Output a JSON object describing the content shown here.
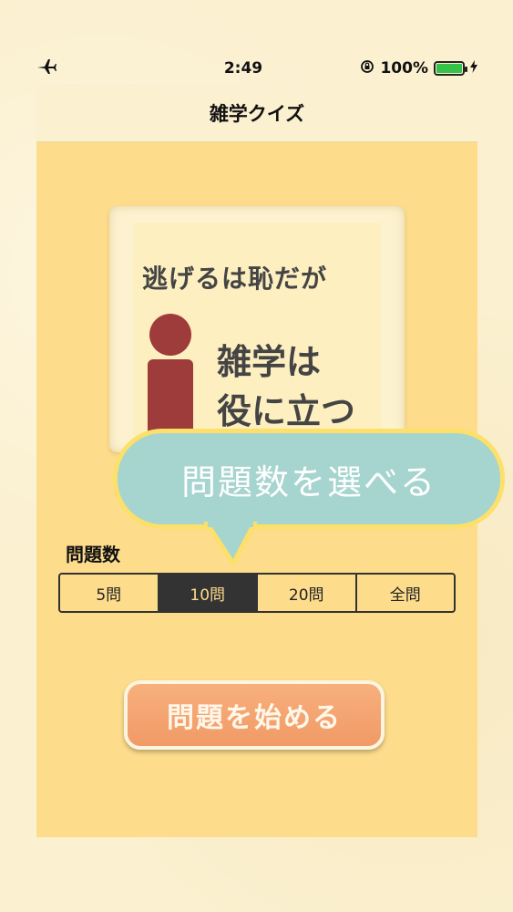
{
  "status_bar": {
    "time": "2:49",
    "battery_percent": "100%",
    "battery_level": 1.0
  },
  "nav": {
    "title": "雑学クイズ"
  },
  "book": {
    "line1": "逃げるは恥だが",
    "line2": "雑学は",
    "line3": "役に立つ"
  },
  "bubble": {
    "text": "問題数を選べる"
  },
  "question_count": {
    "label": "問題数",
    "options": [
      "5問",
      "10問",
      "20問",
      "全問"
    ],
    "selected": "10問"
  },
  "start_button": {
    "label": "問題を始める"
  },
  "colors": {
    "background": "#fbf0cf",
    "panel": "#fddc8c",
    "bubble": "#a6d4cf",
    "bubble_border": "#fde06a",
    "button": "#f19a66",
    "figure": "#9e3b3b",
    "battery": "#35c24a"
  }
}
